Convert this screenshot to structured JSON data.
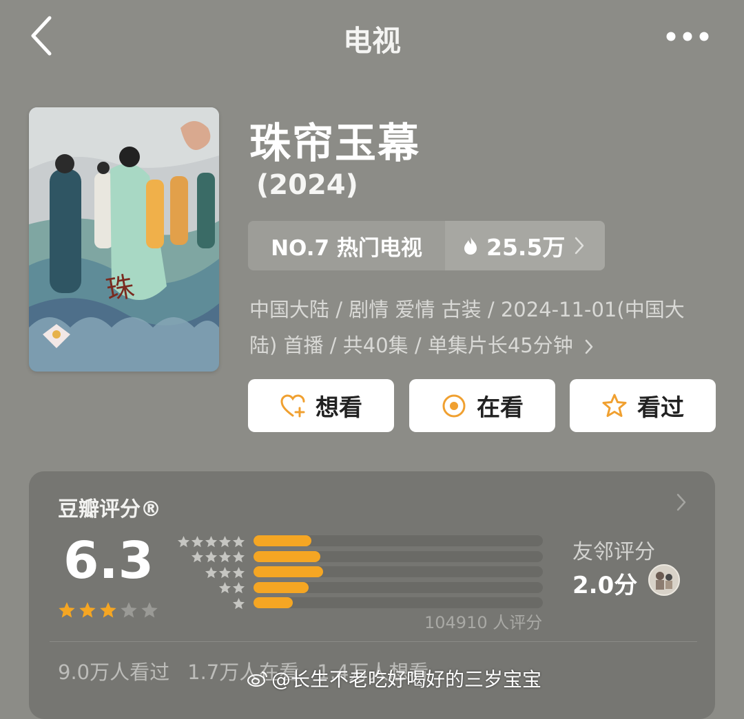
{
  "header": {
    "title": "电视"
  },
  "show": {
    "title": "珠帘玉幕",
    "year": "(2024)",
    "rank_label": "NO.7 热门电视",
    "heat": "25.5万",
    "meta_line1": "中国大陆 / 剧情 爱情 古装 / 2024-11-01(中国大",
    "meta_line2": "陆) 首播 / 共40集 / 单集片长45分钟"
  },
  "actions": {
    "want": "想看",
    "watching": "在看",
    "watched": "看过"
  },
  "rating": {
    "title": "豆瓣评分®",
    "score": "6.3",
    "stars_filled": 3,
    "stars_total": 5,
    "distribution": [
      {
        "stars": 5,
        "fraction": 0.2
      },
      {
        "stars": 4,
        "fraction": 0.23
      },
      {
        "stars": 3,
        "fraction": 0.24
      },
      {
        "stars": 2,
        "fraction": 0.19
      },
      {
        "stars": 1,
        "fraction": 0.135
      }
    ],
    "count_text": "104910 人评分",
    "friend_label": "友邻评分",
    "friend_score": "2.0分"
  },
  "footer": {
    "watched": "9.0万人看过",
    "watching": "1.7万人在看",
    "want": "1.4万人想看"
  },
  "watermark": "@长生不老吃好喝好的三岁宝宝",
  "colors": {
    "background": "#8c8c87",
    "card": "#767672",
    "accent_orange": "#f5a623"
  }
}
